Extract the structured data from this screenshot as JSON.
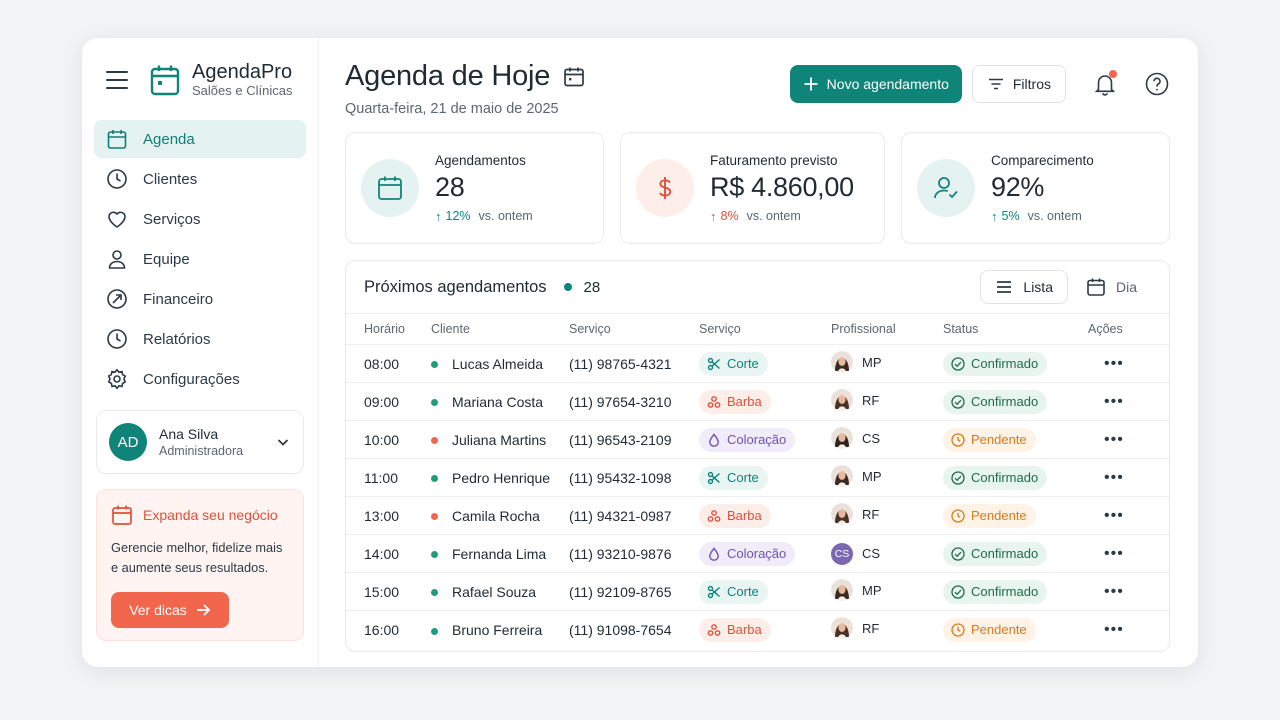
{
  "brand": {
    "name": "AgendaPro",
    "subtitle": "Salões e Clínicas"
  },
  "nav": [
    {
      "label": "Agenda",
      "icon": "calendar-icon",
      "active": true
    },
    {
      "label": "Clientes",
      "icon": "clock-icon"
    },
    {
      "label": "Serviços",
      "icon": "heart-icon"
    },
    {
      "label": "Equipe",
      "icon": "user-icon"
    },
    {
      "label": "Financeiro",
      "icon": "compass-icon"
    },
    {
      "label": "Relatórios",
      "icon": "clock-icon"
    },
    {
      "label": "Configurações",
      "icon": "gear-icon"
    }
  ],
  "user": {
    "initials": "AD",
    "name": "Ana Silva",
    "role": "Administradora"
  },
  "promo": {
    "title": "Expanda seu negócio",
    "text_line1": "Gerencie melhor, fidelize mais",
    "text_line2": "e aumente seus resultados.",
    "button": "Ver dicas"
  },
  "header": {
    "title": "Agenda de Hoje",
    "date": "Quarta-feira, 21 de maio de 2025",
    "new_button": "Novo agendamento",
    "filter_button": "Filtros"
  },
  "stats": [
    {
      "label": "Agendamentos",
      "value": "28",
      "trend": "12%",
      "trend_suffix": "vs. ontem",
      "trend_color": "#0f857a"
    },
    {
      "label": "Faturamento previsto",
      "value": "R$ 4.860,00",
      "trend": "8%",
      "trend_suffix": "vs. ontem",
      "trend_color": "#e0503a"
    },
    {
      "label": "Comparecimento",
      "value": "92%",
      "trend": "5%",
      "trend_suffix": "vs. ontem",
      "trend_color": "#0f857a"
    }
  ],
  "table": {
    "title": "Próximos agendamentos",
    "count": "28",
    "view_list": "Lista",
    "view_day": "Dia",
    "columns": [
      "Horário",
      "Cliente",
      "Serviço",
      "Serviço",
      "Profissional",
      "Status",
      "Ações"
    ],
    "rows": [
      {
        "time": "08:00",
        "client": "Lucas Almeida",
        "phone": "(11) 98765-4321",
        "service": "Corte",
        "pro": "MP",
        "status": "Confirmado",
        "dot": "#1f9d7a"
      },
      {
        "time": "09:00",
        "client": "Mariana Costa",
        "phone": "(11) 97654-3210",
        "service": "Barba",
        "pro": "RF",
        "status": "Confirmado",
        "dot": "#1f9d7a"
      },
      {
        "time": "10:00",
        "client": "Juliana Martins",
        "phone": "(11) 96543-2109",
        "service": "Coloração",
        "pro": "CS",
        "status": "Pendente",
        "dot": "#f2664e"
      },
      {
        "time": "11:00",
        "client": "Pedro Henrique",
        "phone": "(11) 95432-1098",
        "service": "Corte",
        "pro": "MP",
        "status": "Confirmado",
        "dot": "#1f9d7a"
      },
      {
        "time": "13:00",
        "client": "Camila Rocha",
        "phone": "(11) 94321-0987",
        "service": "Barba",
        "pro": "RF",
        "status": "Pendente",
        "dot": "#f2664e"
      },
      {
        "time": "14:00",
        "client": "Fernanda Lima",
        "phone": "(11) 93210-9876",
        "service": "Coloração",
        "pro": "CS",
        "status": "Confirmado",
        "dot": "#1f9d7a"
      },
      {
        "time": "15:00",
        "client": "Rafael Souza",
        "phone": "(11) 92109-8765",
        "service": "Corte",
        "pro": "MP",
        "status": "Confirmado",
        "dot": "#1f9d7a"
      },
      {
        "time": "16:00",
        "client": "Bruno Ferreira",
        "phone": "(11) 91098-7654",
        "service": "Barba",
        "pro": "RF",
        "status": "Pendente",
        "dot": "#1f9d7a"
      }
    ],
    "actions_glyph": "•••"
  },
  "colors": {
    "accent": "#0f857a",
    "coral": "#f2664e"
  }
}
